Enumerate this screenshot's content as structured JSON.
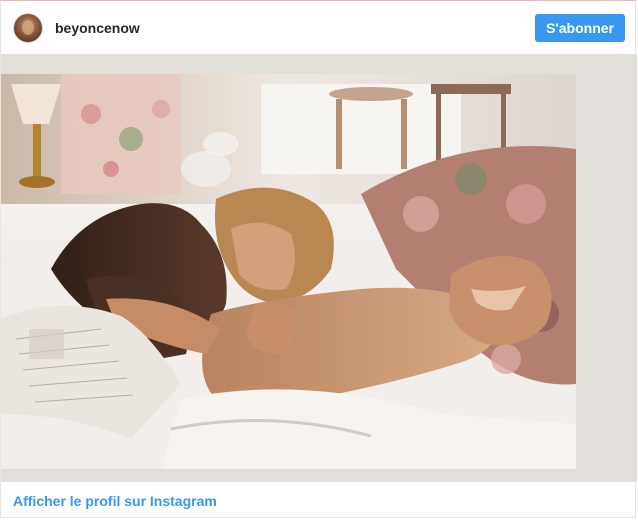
{
  "header": {
    "username": "beyoncenow",
    "follow_label": "S'abonner"
  },
  "footer": {
    "profile_link": "Afficher le profil sur Instagram"
  },
  "colors": {
    "accent": "#3897f0",
    "text": "#262626"
  },
  "icons": {
    "avatar": "profile-photo"
  }
}
